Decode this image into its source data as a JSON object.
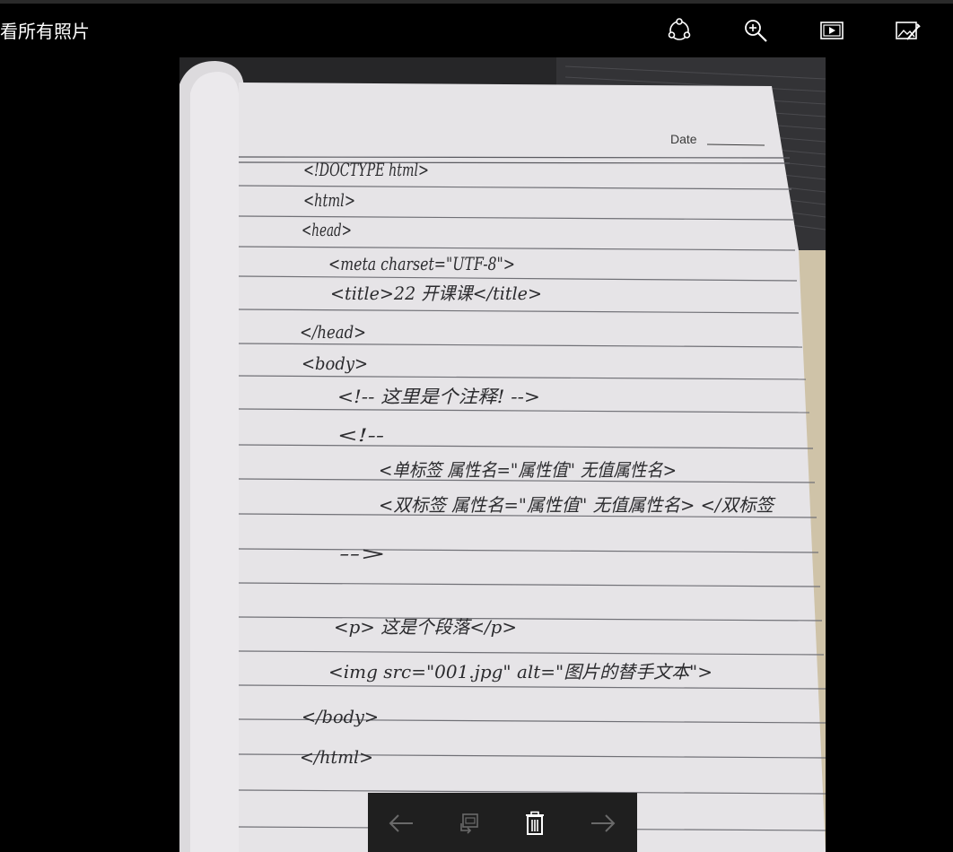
{
  "header": {
    "back_label": "看所有照片"
  },
  "toolbar": {
    "items": [
      {
        "name": "share",
        "icon": "share-icon"
      },
      {
        "name": "zoom",
        "icon": "zoom-in-icon"
      },
      {
        "name": "slideshow",
        "icon": "slideshow-icon"
      },
      {
        "name": "edit",
        "icon": "edit-image-icon"
      }
    ]
  },
  "photo": {
    "date_label": "Date",
    "lines": [
      "<!DOCTYPE html>",
      "<html>",
      "<head>",
      "<meta charset=\"UTF-8\">",
      "<title>22 开课课</title>",
      "</head>",
      "<body>",
      "<!-- 这里是个注释! -->",
      "<!--",
      "<单标签 属性名=\"属性值\" 无值属性名>",
      "<双标签 属性名=\"属性值\" 无值属性名> </双标签",
      "-->",
      "<p> 这是个段落</p>",
      "<img src=\"001.jpg\" alt=\"图片的替手文本\">",
      "</body>",
      "</html>"
    ]
  },
  "bottom_bar": {
    "items": [
      {
        "name": "previous",
        "icon": "arrow-left-icon",
        "enabled": false
      },
      {
        "name": "rotate",
        "icon": "rotate-icon",
        "enabled": false
      },
      {
        "name": "delete",
        "icon": "trash-icon",
        "enabled": true
      },
      {
        "name": "next",
        "icon": "arrow-right-icon",
        "enabled": false
      }
    ]
  },
  "colors": {
    "background": "#000000",
    "toolbar_icon": "#ffffff",
    "bottom_bar": "#1f1f1f",
    "disabled_icon": "#6a6a6a",
    "paper": "#e6e4e7",
    "ink": "#2b2b2e"
  }
}
